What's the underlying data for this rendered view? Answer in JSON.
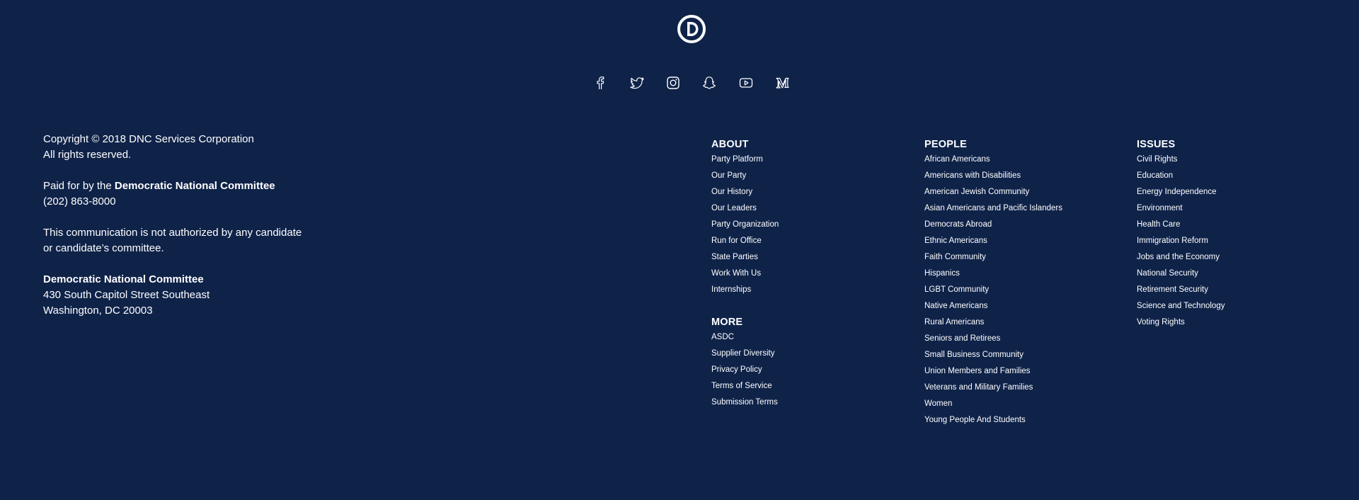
{
  "social": {
    "icons": [
      "facebook-icon",
      "twitter-icon",
      "instagram-icon",
      "snapchat-icon",
      "youtube-icon",
      "medium-icon"
    ]
  },
  "legal": {
    "copyright": "Copyright © 2018 DNC Services Corporation",
    "rights": "All rights reserved.",
    "paid_for_prefix": "Paid for by the ",
    "paid_for_org": "Democratic National Committee",
    "phone": "(202) 863-8000",
    "disclaimer_line1": "This communication is not authorized by any candidate",
    "disclaimer_line2": "or candidate’s committee.",
    "address_org": "Democratic National Committee",
    "address_street": "430 South Capitol Street Southeast",
    "address_city": "Washington, DC 20003"
  },
  "about": {
    "heading": "ABOUT",
    "items": [
      "Party Platform",
      "Our Party",
      "Our History",
      "Our Leaders",
      "Party Organization",
      "Run for Office",
      "State Parties",
      "Work With Us",
      "Internships"
    ]
  },
  "more": {
    "heading": "MORE",
    "items": [
      "ASDC",
      "Supplier Diversity",
      "Privacy Policy",
      "Terms of Service",
      "Submission Terms"
    ]
  },
  "people": {
    "heading": "PEOPLE",
    "items": [
      "African Americans",
      "Americans with Disabilities",
      "American Jewish Community",
      "Asian Americans and Pacific Islanders",
      "Democrats Abroad",
      "Ethnic Americans",
      "Faith Community",
      "Hispanics",
      "LGBT Community",
      "Native Americans",
      "Rural Americans",
      "Seniors and Retirees",
      "Small Business Community",
      "Union Members and Families",
      "Veterans and Military Families",
      "Women",
      "Young People And Students"
    ]
  },
  "issues": {
    "heading": "ISSUES",
    "items": [
      "Civil Rights",
      "Education",
      "Energy Independence",
      "Environment",
      "Health Care",
      "Immigration Reform",
      "Jobs and the Economy",
      "National Security",
      "Retirement Security",
      "Science and Technology",
      "Voting Rights"
    ]
  },
  "colors": {
    "background": "#0f2349",
    "text": "#ffffff"
  }
}
